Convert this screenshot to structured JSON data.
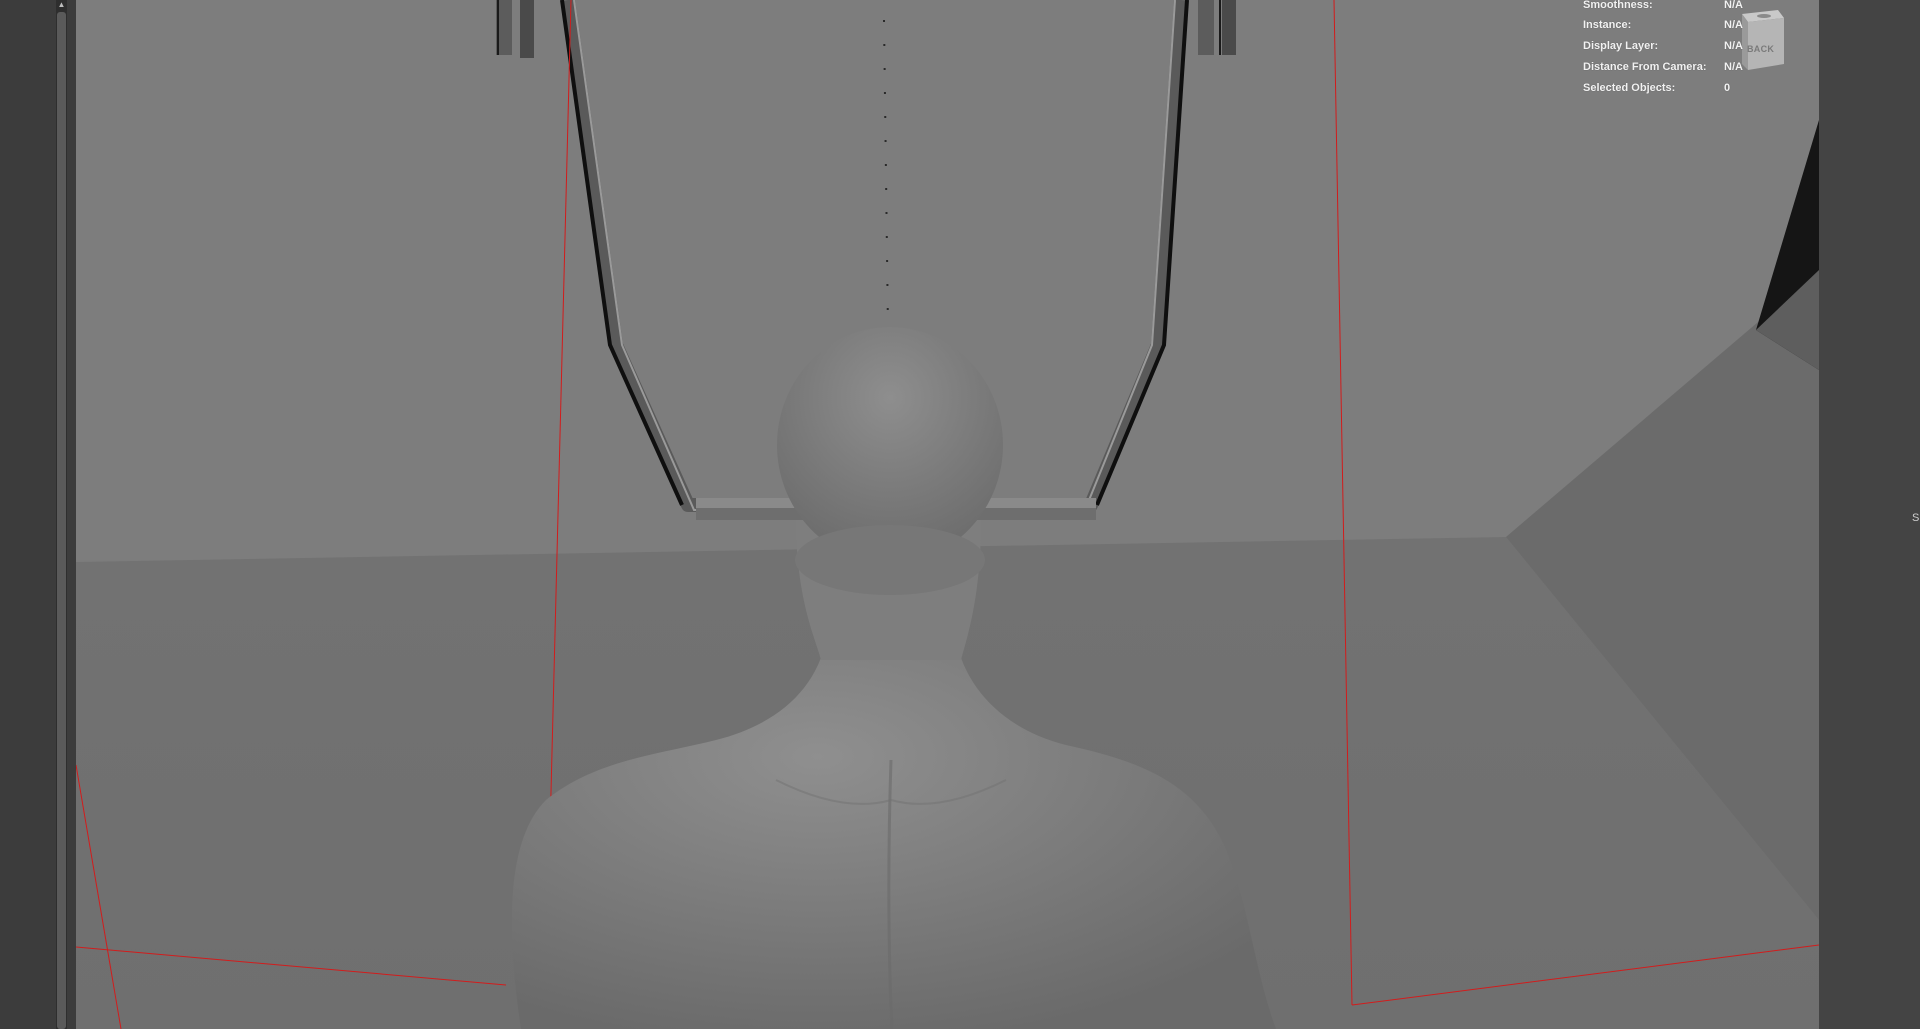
{
  "hud": {
    "rows": [
      {
        "label": "Smoothness:",
        "value": "N/A"
      },
      {
        "label": "Instance:",
        "value": "N/A"
      },
      {
        "label": "Display Layer:",
        "value": "N/A"
      },
      {
        "label": "Distance From Camera:",
        "value": "N/A"
      },
      {
        "label": "Selected Objects:",
        "value": "0"
      }
    ]
  },
  "view_cube": {
    "face_label": "BACK"
  },
  "right_panel": {
    "edge_glyph": "S"
  },
  "icons": {
    "scroll_up": "triangle-up"
  }
}
